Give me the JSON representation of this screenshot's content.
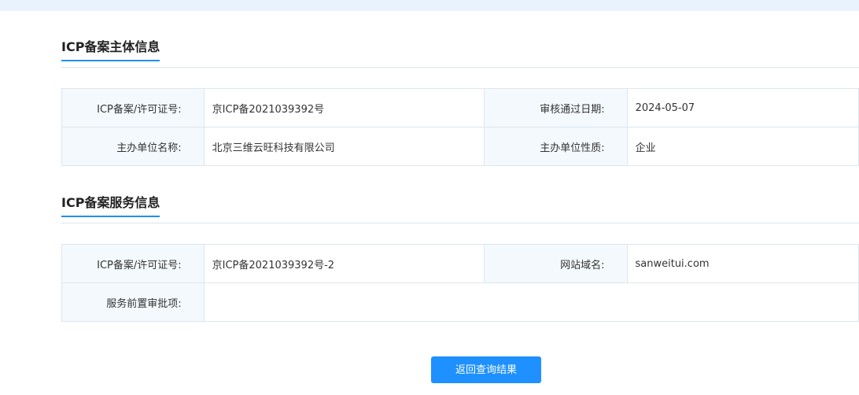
{
  "sections": [
    {
      "title": "ICP备案主体信息",
      "rows": [
        [
          {
            "label": "ICP备案/许可证号:",
            "value": "京ICP备2021039392号"
          },
          {
            "label": "审核通过日期:",
            "value": "2024-05-07"
          }
        ],
        [
          {
            "label": "主办单位名称:",
            "value": "北京三维云旺科技有限公司"
          },
          {
            "label": "主办单位性质:",
            "value": "企业"
          }
        ]
      ]
    },
    {
      "title": "ICP备案服务信息",
      "rows": [
        [
          {
            "label": "ICP备案/许可证号:",
            "value": "京ICP备2021039392号-2"
          },
          {
            "label": "网站域名:",
            "value": "sanweitui.com"
          }
        ],
        [
          {
            "label": "服务前置审批项:",
            "value": ""
          }
        ]
      ]
    }
  ],
  "back_button": {
    "label": "返回查询结果"
  },
  "colors": {
    "accent": "#1e90ff",
    "label_bg": "#f4f9fd",
    "border": "#dde6ee",
    "top_bar": "#e8f3fd"
  }
}
